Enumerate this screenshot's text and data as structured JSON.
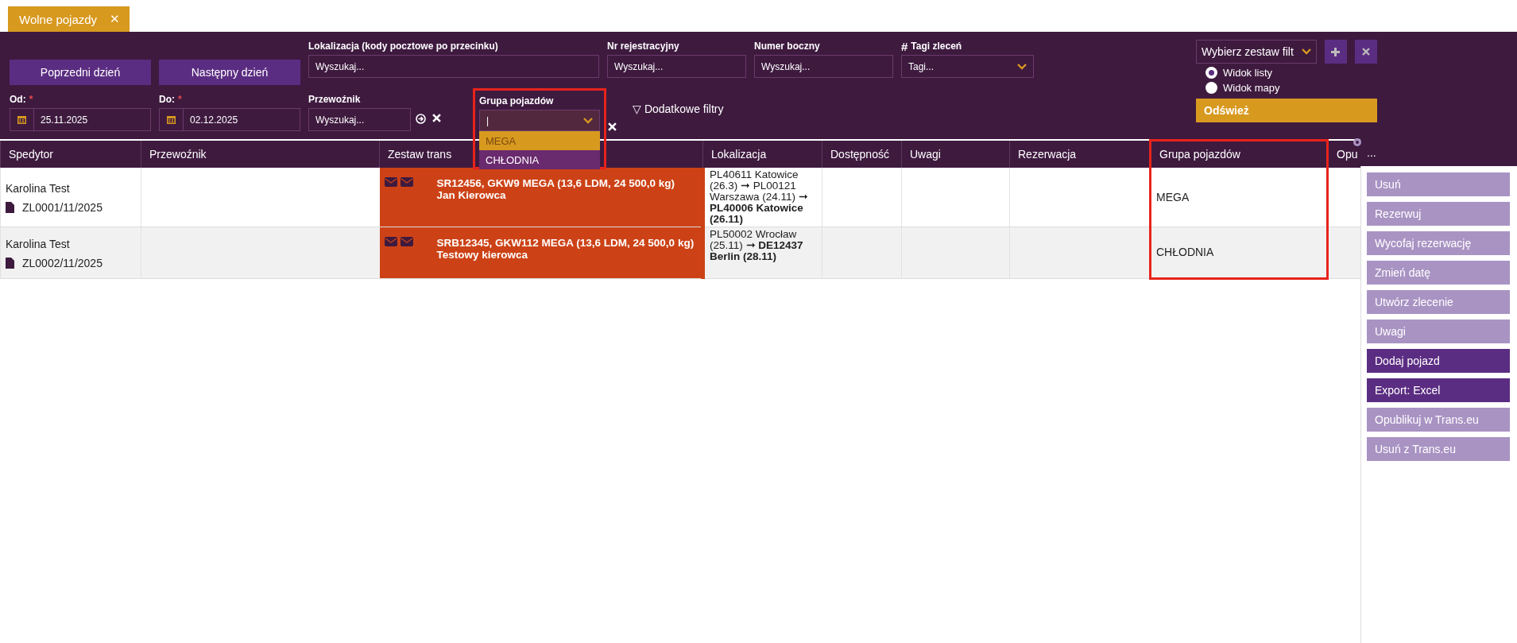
{
  "tab": {
    "label": "Wolne pojazdy",
    "close": "✕"
  },
  "filters": {
    "prev_day": "Poprzedni dzień",
    "next_day": "Następny dzień",
    "location": {
      "label": "Lokalizacja (kody pocztowe po przecinku)",
      "placeholder": "Wyszukaj..."
    },
    "registration": {
      "label": "Nr rejestracyjny",
      "placeholder": "Wyszukaj..."
    },
    "side_number": {
      "label": "Numer boczny",
      "placeholder": "Wyszukaj..."
    },
    "tags": {
      "hash": "#",
      "label": "Tagi zleceń",
      "placeholder": "Tagi..."
    },
    "from": {
      "label": "Od:",
      "required_mark": "*",
      "value": "25.11.2025"
    },
    "to": {
      "label": "Do:",
      "required_mark": "*",
      "value": "02.12.2025"
    },
    "carrier": {
      "label": "Przewoźnik",
      "placeholder": "Wyszukaj..."
    },
    "vehicle_group": {
      "label": "Grupa pojazdów",
      "value": "|",
      "expanded": true,
      "highlighted": true,
      "options": [
        {
          "label": "MEGA",
          "selected": true
        },
        {
          "label": "CHŁODNIA",
          "selected": false
        }
      ]
    },
    "more_filters": "▽ Dodatkowe filtry"
  },
  "filter_set": {
    "placeholder": "Wybierz zestaw filt"
  },
  "views": [
    {
      "label": "Widok listy",
      "selected": true
    },
    {
      "label": "Widok mapy",
      "selected": false
    }
  ],
  "refresh": "Odśwież",
  "table": {
    "columns": [
      {
        "label": "Spedytor",
        "highlighted": false
      },
      {
        "label": "Przewoźnik",
        "highlighted": false
      },
      {
        "label": "Zestaw trans",
        "highlighted": false
      },
      {
        "label": "Lokalizacja",
        "highlighted": false
      },
      {
        "label": "Dostępność",
        "highlighted": false
      },
      {
        "label": "Uwagi",
        "highlighted": false
      },
      {
        "label": "Rezerwacja",
        "highlighted": false
      },
      {
        "label": "Grupa pojazdów",
        "highlighted": true
      },
      {
        "label": "Opu",
        "highlighted": false
      }
    ],
    "column_menu": "...",
    "rows": [
      {
        "forwarder": "Karolina Test",
        "order": "ZL0001/11/2025",
        "carrier": "",
        "set_line1": "SR12456, GKW9 MEGA (13,6 LDM, 24 500,0 kg)",
        "set_line2": "Jan Kierowca",
        "location": "PL40611 Katowice (26.3) ➞ PL00121 Warszawa (24.11) ➞ **PL40006 Katowice (26.11)**",
        "group": "MEGA"
      },
      {
        "forwarder": "Karolina Test",
        "order": "ZL0002/11/2025",
        "carrier": "",
        "set_line1": "SRB12345, GKW112 MEGA (13,6 LDM, 24 500,0 kg)",
        "set_line2": "Testowy kierowca",
        "location": "PL50002 Wrocław (25.11) ➞ **DE12437 Berlin (28.11)**",
        "group": "CHŁODNIA"
      }
    ]
  },
  "actions": [
    {
      "label": "Usuń",
      "kind": "light"
    },
    {
      "label": "Rezerwuj",
      "kind": "light"
    },
    {
      "label": "Wycofaj rezerwację",
      "kind": "light"
    },
    {
      "label": "Zmień datę",
      "kind": "light"
    },
    {
      "label": "Utwórz zlecenie",
      "kind": "light"
    },
    {
      "label": "Uwagi",
      "kind": "light"
    },
    {
      "label": "Dodaj pojazd",
      "kind": "dark"
    },
    {
      "label": "Export: Excel",
      "kind": "dark"
    },
    {
      "label": "Opublikuj w Trans.eu",
      "kind": "light"
    },
    {
      "label": "Usuń z Trans.eu",
      "kind": "light"
    }
  ]
}
